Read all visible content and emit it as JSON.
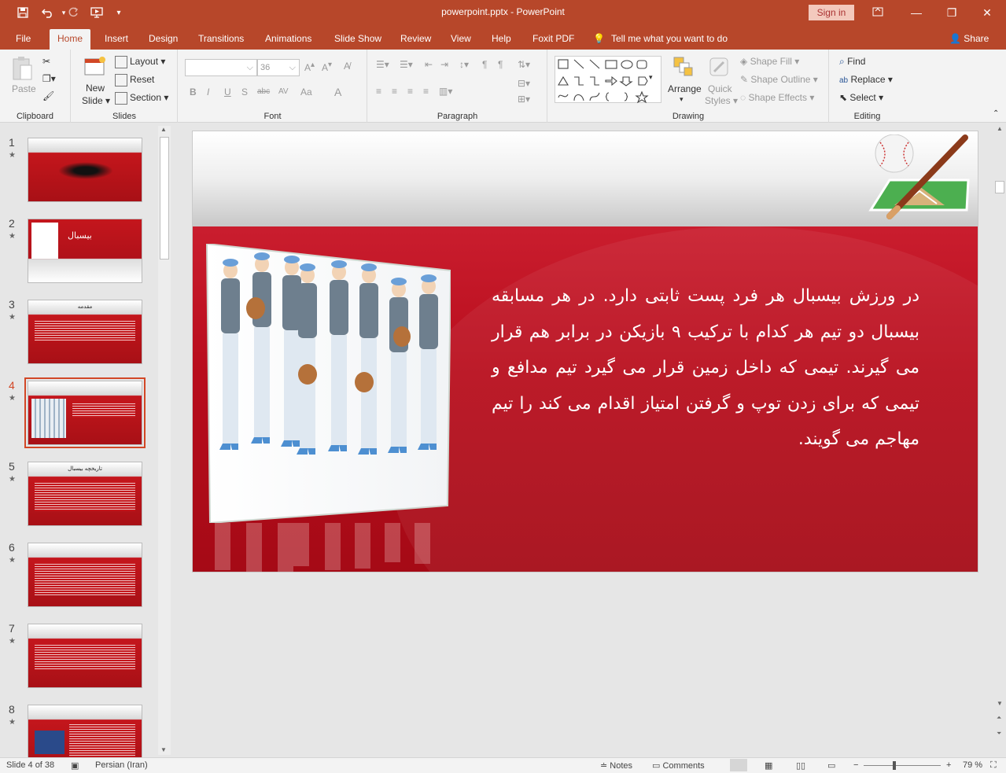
{
  "window": {
    "title": "powerpoint.pptx  -  PowerPoint",
    "signin_label": "Sign in",
    "share_label": "Share",
    "tell_me": "Tell me what you want to do"
  },
  "tabs": [
    "File",
    "Home",
    "Insert",
    "Design",
    "Transitions",
    "Animations",
    "Slide Show",
    "Review",
    "View",
    "Help",
    "Foxit PDF"
  ],
  "active_tab": "Home",
  "ribbon": {
    "clipboard": {
      "label": "Clipboard",
      "paste": "Paste"
    },
    "slides": {
      "label": "Slides",
      "new_slide": "New",
      "new_slide_2": "Slide",
      "layout": "Layout",
      "reset": "Reset",
      "section": "Section"
    },
    "font": {
      "label": "Font",
      "size": "36",
      "bold": "B",
      "italic": "I",
      "underline": "U",
      "shadow": "S",
      "strike": "abc",
      "spacing": "AV",
      "case": "Aa",
      "color": "A"
    },
    "paragraph": {
      "label": "Paragraph"
    },
    "drawing": {
      "label": "Drawing",
      "arrange": "Arrange",
      "quick_styles": "Quick",
      "quick_styles_2": "Styles",
      "shape_fill": "Shape Fill",
      "shape_outline": "Shape Outline",
      "shape_effects": "Shape Effects"
    },
    "editing": {
      "label": "Editing",
      "find": "Find",
      "replace": "Replace",
      "select": "Select"
    }
  },
  "thumbnails": [
    {
      "num": "1",
      "title": ""
    },
    {
      "num": "2",
      "title": "بیسبال"
    },
    {
      "num": "3",
      "title": "مقدمه"
    },
    {
      "num": "4",
      "title": ""
    },
    {
      "num": "5",
      "title": "تاریخچه بیسبال"
    },
    {
      "num": "6",
      "title": ""
    },
    {
      "num": "7",
      "title": ""
    },
    {
      "num": "8",
      "title": ""
    }
  ],
  "selected_slide": "4",
  "slide": {
    "body_text": "در ورزش بیسبال هر فرد پست ثابتی دارد. در هر مسابقه بیسبال دو تیم هر کدام با ترکیب ۹ بازیکن در برابر هم قرار می گیرند. تیمی که داخل زمین قرار می گیرد تیم مدافع و تیمی که برای زدن توپ و گرفتن امتیاز اقدام می کند را تیم مهاجم می گویند."
  },
  "status": {
    "slide_count": "Slide 4 of 38",
    "language": "Persian (Iran)",
    "notes": "Notes",
    "comments": "Comments",
    "zoom": "79 %"
  },
  "colors": {
    "accent": "#b7472a",
    "slide_red": "#c4161c"
  }
}
